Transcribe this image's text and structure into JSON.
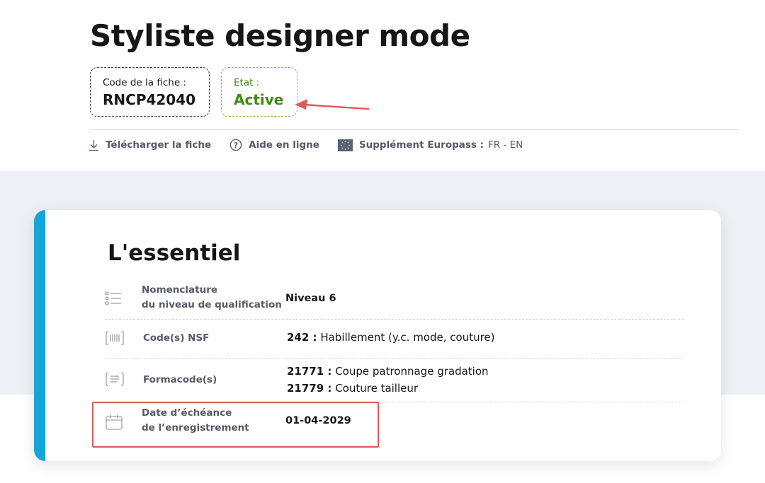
{
  "header": {
    "title": "Styliste designer mode",
    "code_label": "Code de la fiche :",
    "code_value": "RNCP42040",
    "etat_label": "Etat :",
    "etat_value": "Active"
  },
  "links": {
    "download": "Télécharger la fiche",
    "help": "Aide en ligne",
    "europass_label": "Supplément Europass :",
    "europass_langs": "FR - EN"
  },
  "essentiel": {
    "title": "L'essentiel",
    "rows": [
      {
        "label_1": "Nomenclature",
        "label_2": "du niveau de qualification",
        "value": "Niveau 6"
      },
      {
        "label": "Code(s) NSF",
        "code": "242 :",
        "text": "Habillement (y.c. mode, couture)"
      },
      {
        "label": "Formacode(s)",
        "lines": [
          {
            "code": "21771 :",
            "text": "Coupe patronnage gradation"
          },
          {
            "code": "21779 :",
            "text": "Couture tailleur"
          }
        ]
      },
      {
        "label_1": "Date d’échéance",
        "label_2": "de l’enregistrement",
        "value": "01-04-2029"
      }
    ]
  },
  "colors": {
    "active_green": "#3f8b10",
    "accent_blue": "#16a5d8",
    "annotation_red": "#df5a5a"
  }
}
